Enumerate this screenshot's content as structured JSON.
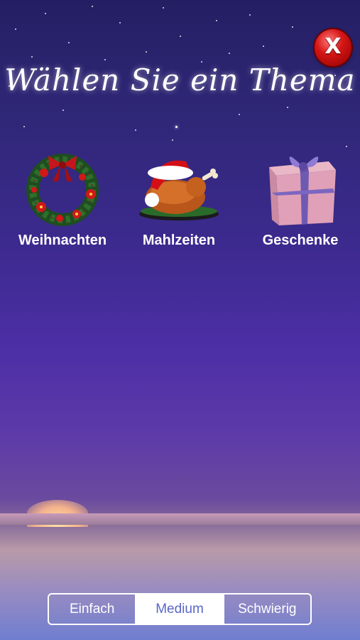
{
  "title": "Wählen Sie ein Thema",
  "close_button": {
    "label": "X",
    "icon": "close-icon",
    "color": "#d61616"
  },
  "themes": [
    {
      "label": "Weihnachten",
      "icon": "wreath-icon"
    },
    {
      "label": "Mahlzeiten",
      "icon": "roast-turkey-icon"
    },
    {
      "label": "Geschenke",
      "icon": "gift-box-icon"
    }
  ],
  "difficulty": {
    "options": [
      "Einfach",
      "Medium",
      "Schwierig"
    ],
    "selected": "Medium"
  },
  "colors": {
    "accent": "#5a67c5",
    "sky_top": "#241f63",
    "sky_bottom": "#6f7ed0"
  }
}
